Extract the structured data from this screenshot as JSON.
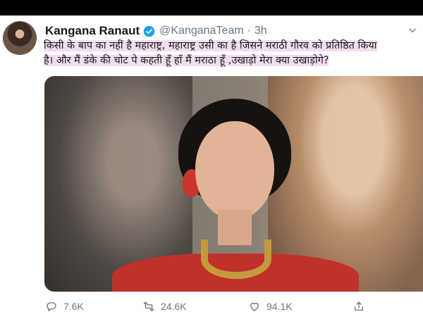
{
  "tweet": {
    "author_name": "Kangana Ranaut",
    "author_handle": "@KanganaTeam",
    "separator": "·",
    "time": "3h",
    "text_line1": "किसी के बाप का नहीं है महाराष्ट्र, महाराष्ट्र उसी का है जिसने मराठी गौरव को प्रतिष्ठित किया",
    "text_line2": "है। और मैं डंके की चोट पे कहती हूँ हाँ मैं मराठा हूँ ,उखाड़ो मेरा क्या उखाड़ोगे?",
    "highlight_color": "#f2ddf0"
  },
  "actions": {
    "reply_count": "7.6K",
    "retweet_count": "24.6K",
    "like_count": "94.1K"
  },
  "colors": {
    "name": "#14171a",
    "secondary": "#657786",
    "verified": "#1da1f2",
    "frame": "#000000"
  }
}
